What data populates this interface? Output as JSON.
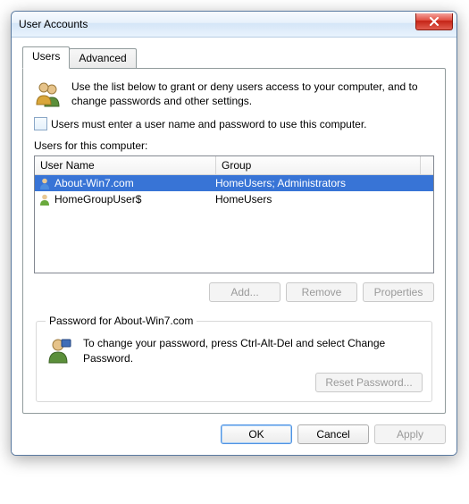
{
  "title": "User Accounts",
  "tabs": {
    "users": "Users",
    "advanced": "Advanced"
  },
  "intro": "Use the list below to grant or deny users access to your computer, and to change passwords and other settings.",
  "checkbox_label": "Users must enter a user name and password to use this computer.",
  "users_label": "Users for this computer:",
  "columns": {
    "name": "User Name",
    "group": "Group"
  },
  "rows": [
    {
      "name": "About-Win7.com",
      "group": "HomeUsers; Administrators",
      "selected": true
    },
    {
      "name": "HomeGroupUser$",
      "group": "HomeUsers",
      "selected": false
    }
  ],
  "buttons": {
    "add": "Add...",
    "remove": "Remove",
    "properties": "Properties"
  },
  "password_group_title": "Password for About-Win7.com",
  "password_text": "To change your password, press Ctrl-Alt-Del and select Change Password.",
  "reset_password": "Reset Password...",
  "ok": "OK",
  "cancel": "Cancel",
  "apply": "Apply"
}
